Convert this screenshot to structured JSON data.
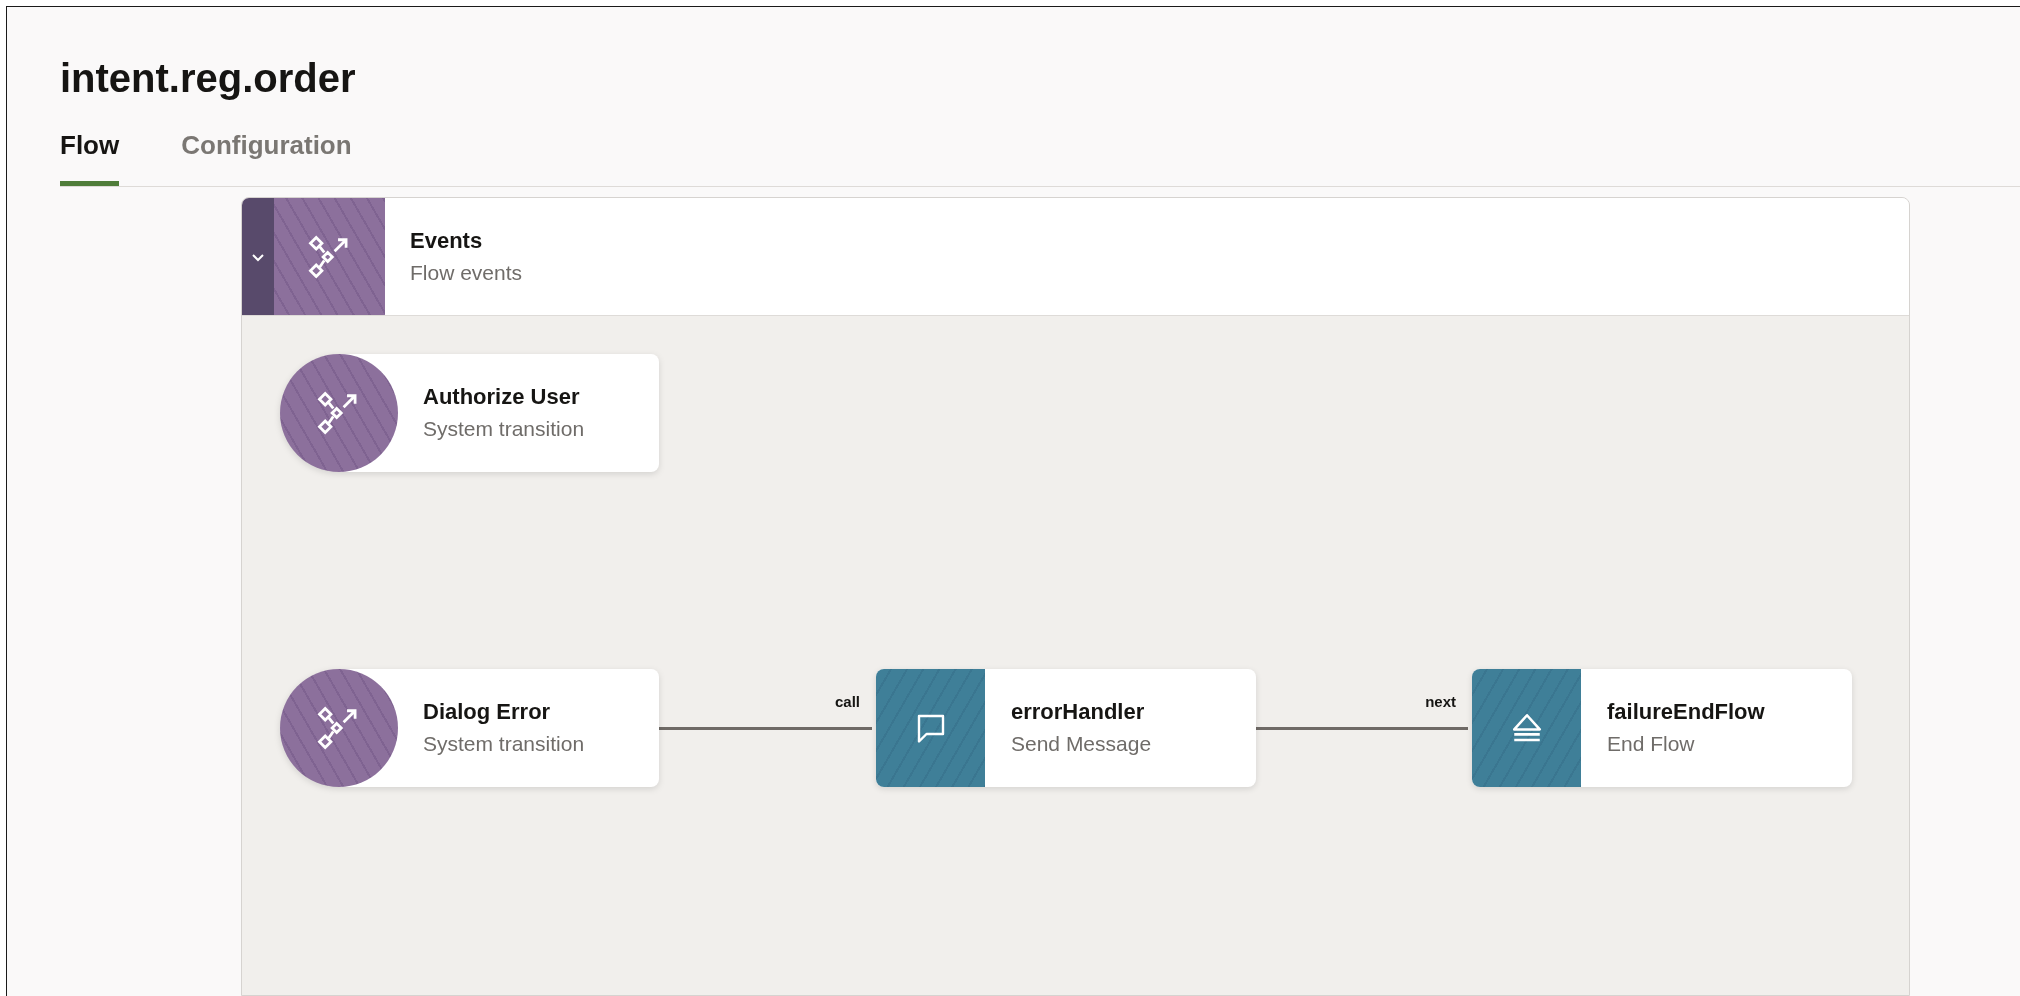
{
  "title": "intent.reg.order",
  "tabs": [
    {
      "label": "Flow",
      "selected": true
    },
    {
      "label": "Configuration",
      "selected": false
    }
  ],
  "panel": {
    "title": "Events",
    "subtitle": "Flow events",
    "expanded": true
  },
  "nodes": [
    {
      "title": "Authorize User",
      "subtitle": "System transition",
      "kind": "transition"
    },
    {
      "title": "Dialog Error",
      "subtitle": "System transition",
      "kind": "transition"
    },
    {
      "title": "errorHandler",
      "subtitle": "Send Message",
      "kind": "message"
    },
    {
      "title": "failureEndFlow",
      "subtitle": "End Flow",
      "kind": "end"
    }
  ],
  "edges": [
    {
      "label": "call"
    },
    {
      "label": "next"
    }
  ]
}
